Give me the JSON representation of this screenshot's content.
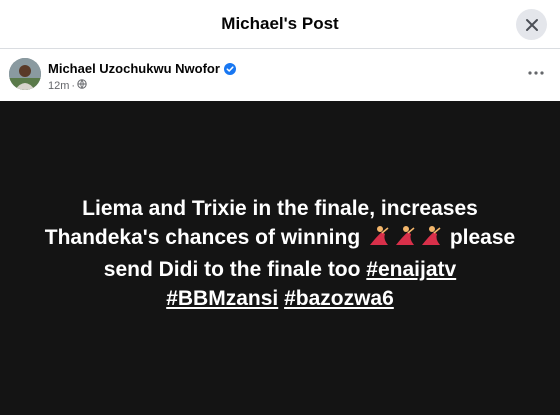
{
  "header": {
    "title": "Michael's Post",
    "close_icon": "close-icon"
  },
  "post": {
    "author": "Michael Uzochukwu Nwofor",
    "verified": true,
    "time": "12m",
    "dot": "·",
    "audience_icon": "globe-icon",
    "more_icon": "more-horizontal-icon",
    "text_line1": "Liema and Trixie in the finale, increases",
    "text_line2a": "Thandeka's chances of winning ",
    "emoji_name": "dancing-woman-emoji",
    "text_line2b": " please",
    "text_line3a": "send Didi to the finale too ",
    "hashtag1": "#enaijatv",
    "hashtag2": "#BBMzansi",
    "hashtag3": "#bazozwa6",
    "background": "#141414",
    "text_color": "#ffffff"
  },
  "colors": {
    "verified_blue": "#1877f2",
    "muted": "#65676b"
  }
}
